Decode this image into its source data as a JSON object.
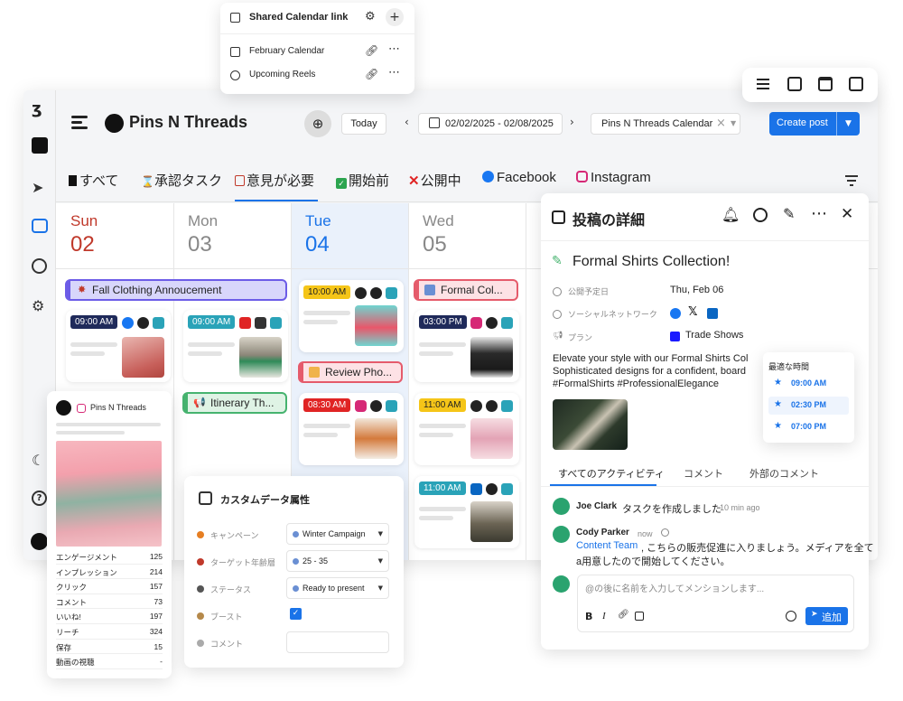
{
  "header": {
    "app_title": "Pins N Threads",
    "today": "Today",
    "date_range": "02/02/2025 - 02/08/2025",
    "calendar_select": "Pins N Threads Calendar",
    "create_post": "Create post"
  },
  "popup": {
    "title": "Shared Calendar link",
    "items": [
      {
        "label": "February Calendar"
      },
      {
        "label": "Upcoming Reels"
      }
    ]
  },
  "filters": [
    {
      "label": "すべて"
    },
    {
      "label": "承認タスク"
    },
    {
      "label": "意見が必要"
    },
    {
      "label": "開始前"
    },
    {
      "label": "公開中"
    },
    {
      "label": "Facebook"
    },
    {
      "label": "Instagram"
    }
  ],
  "days": [
    {
      "name": "Sun",
      "num": "02"
    },
    {
      "name": "Mon",
      "num": "03"
    },
    {
      "name": "Tue",
      "num": "04"
    },
    {
      "name": "Wed",
      "num": "05"
    }
  ],
  "events": {
    "fall_clothing": "Fall Clothing Annoucement",
    "formal_col": "Formal Col...",
    "review_pho": "Review Pho...",
    "itinerary": "Itinerary Th..."
  },
  "times": {
    "sun": "09:00 AM",
    "mon": "09:00 AM",
    "tue1": "10:00 AM",
    "tue2": "08:30 AM",
    "wed1": "03:00 PM",
    "wed2": "11:00 AM",
    "wed3": "11:00 AM"
  },
  "insta_card": {
    "account": "Pins N Threads",
    "stats": [
      {
        "k": "エンゲージメント",
        "v": "125"
      },
      {
        "k": "インプレッション",
        "v": "214"
      },
      {
        "k": "クリック",
        "v": "157"
      },
      {
        "k": "コメント",
        "v": "73"
      },
      {
        "k": "いいね!",
        "v": "197"
      },
      {
        "k": "リーチ",
        "v": "324"
      },
      {
        "k": "保存",
        "v": "15"
      },
      {
        "k": "動画の視聴",
        "v": "-"
      }
    ]
  },
  "custom_data": {
    "title": "カスタムデータ属性",
    "rows": [
      {
        "k": "キャンペーン",
        "v": "Winter Campaign"
      },
      {
        "k": "ターゲット年齢層",
        "v": "25 - 35"
      },
      {
        "k": "ステータス",
        "v": "Ready to present"
      },
      {
        "k": "ブースト",
        "v": ""
      },
      {
        "k": "コメント",
        "v": ""
      }
    ]
  },
  "detail": {
    "header": "投稿の詳細",
    "post_title": "Formal Shirts Collection!",
    "schedule_label": "公開予定日",
    "schedule_value": "Thu, Feb 06",
    "network_label": "ソーシャルネットワーク",
    "plan_label": "プラン",
    "plan_value": "Trade Shows",
    "body_line1": "Elevate your style with our Formal Shirts Col",
    "body_line2": "Sophisticated designs for a confident, board",
    "body_line3": "#FormalShirts #ProfessionalElegance",
    "best_time_title": "最適な時間",
    "best_times": [
      "09:00 AM",
      "02:30 PM",
      "07:00 PM"
    ],
    "tabs": [
      "すべてのアクティビティ",
      "コメント",
      "外部のコメント"
    ],
    "activity1_user": "Joe Clark",
    "activity1_text": "タスクを作成しました",
    "activity1_time": "10 min ago",
    "activity2_user": "Cody Parker",
    "activity2_time": "now",
    "activity2_mention": "Content Team",
    "activity2_text1": ", こちらの販売促進に入りましょう。メディアを全て",
    "activity2_text2": "a用意したので開始してください。",
    "comment_placeholder": "@の後に名前を入力してメンションします...",
    "add_button": "追加"
  },
  "colors": {
    "primary": "#1a73e8",
    "sunday": "#c0392b",
    "tuesday": "#1a73e8",
    "purple_event": "#6c5ce7",
    "red_event": "#e55b6b",
    "green_event": "#46b36f",
    "time_navy": "#1f2a5a",
    "time_red": "#e02424",
    "time_yellow": "#f5c518",
    "time_teal": "#2aa3b8"
  }
}
